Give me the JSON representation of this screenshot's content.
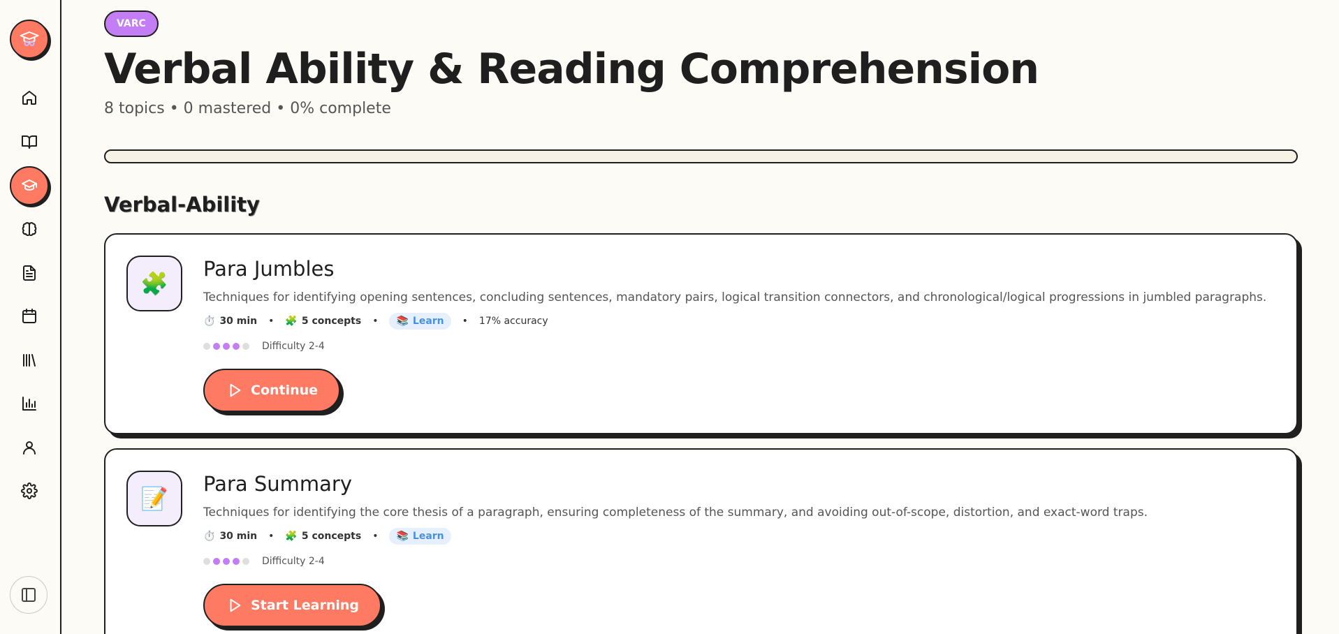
{
  "sidebar": {
    "logo_icon": "graduation-cap-glasses-icon",
    "items": [
      {
        "icon": "home-icon",
        "active": false
      },
      {
        "icon": "book-open-icon",
        "active": false
      },
      {
        "icon": "graduation-cap-icon",
        "active": true
      },
      {
        "icon": "brain-icon",
        "active": false
      },
      {
        "icon": "document-icon",
        "active": false
      },
      {
        "icon": "calendar-icon",
        "active": false
      },
      {
        "icon": "library-icon",
        "active": false
      },
      {
        "icon": "bar-chart-icon",
        "active": false
      },
      {
        "icon": "user-icon",
        "active": false
      },
      {
        "icon": "settings-icon",
        "active": false
      }
    ],
    "collapse_icon": "panel-left-icon"
  },
  "header": {
    "badge": "VARC",
    "title": "Verbal Ability & Reading Comprehension",
    "subtitle": "8 topics • 0 mastered • 0% complete",
    "progress_percent": 0
  },
  "section": {
    "title": "Verbal-Ability"
  },
  "topics": [
    {
      "icon": "puzzle-icon",
      "title": "Para Jumbles",
      "description": "Techniques for identifying opening sentences, concluding sentences, mandatory pairs, logical transition connectors, and chronological/logical progressions in jumbled paragraphs.",
      "duration": "30 min",
      "concepts": "5 concepts",
      "mode": "Learn",
      "accuracy": "17% accuracy",
      "difficulty_level": 3,
      "difficulty_max": 5,
      "difficulty_label": "Difficulty 2-4",
      "action_label": "Continue"
    },
    {
      "icon": "memo-icon",
      "title": "Para Summary",
      "description": "Techniques for identifying the core thesis of a paragraph, ensuring completeness of the summary, and avoiding out-of-scope, distortion, and exact-word traps.",
      "duration": "30 min",
      "concepts": "5 concepts",
      "mode": "Learn",
      "accuracy": null,
      "difficulty_level": 3,
      "difficulty_max": 5,
      "difficulty_label": "Difficulty 2-4",
      "action_label": "Start Learning"
    }
  ],
  "colors": {
    "accent": "#ff7a63",
    "badge": "#c47ef5",
    "background": "#fdfbf6",
    "learn": "#4a90e2"
  }
}
